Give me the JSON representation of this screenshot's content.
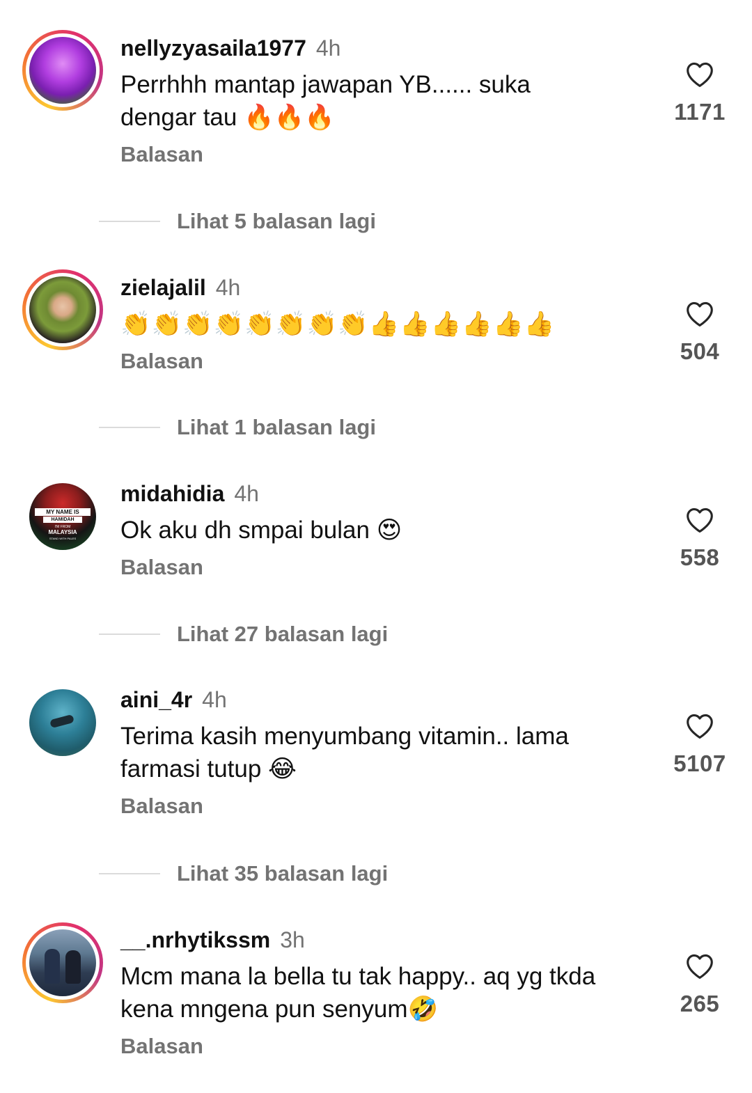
{
  "comments": [
    {
      "username": "nellyzyasaila1977",
      "time": "4h",
      "text": "Perrhhh mantap jawapan YB...... suka dengar tau 🔥🔥🔥",
      "reply_label": "Balasan",
      "likes": "1171",
      "more_replies": "Lihat 5 balasan lagi",
      "avatar_icon": "purple-rose-photo"
    },
    {
      "username": "zielajalil",
      "time": "4h",
      "text": "👏👏👏👏👏👏👏👏👍👍👍👍👍👍",
      "reply_label": "Balasan",
      "likes": "504",
      "more_replies": "Lihat 1 balasan lagi",
      "avatar_icon": "woman-hijab-photo"
    },
    {
      "username": "midahidia",
      "time": "4h",
      "text": "Ok aku dh smpai bulan 😍",
      "reply_label": "Balasan",
      "likes": "558",
      "more_replies": "Lihat 27 balasan lagi",
      "avatar_icon": "badge-photo",
      "avatar_text": [
        "MY NAME IS",
        "HAMIDAH",
        "I'M FROM",
        "MALAYSIA",
        "STAND WITH PALES"
      ]
    },
    {
      "username": "aini_4r",
      "time": "4h",
      "text": "Terima kasih menyumbang vitamin.. lama farmasi tutup 😂",
      "reply_label": "Balasan",
      "likes": "5107",
      "more_replies": "Lihat 35 balasan lagi",
      "avatar_icon": "scuba-diver-photo"
    },
    {
      "username": "__.nrhytikssm",
      "time": "3h",
      "text": "Mcm mana la bella tu tak happy.. aq yg tkda kena mngena pun senyum🤣",
      "reply_label": "Balasan",
      "likes": "265",
      "avatar_icon": "couple-photo"
    }
  ],
  "colors": {
    "secondary_text": "#737373",
    "divider": "#dbdbdb",
    "story_ring": "#e1306c"
  }
}
